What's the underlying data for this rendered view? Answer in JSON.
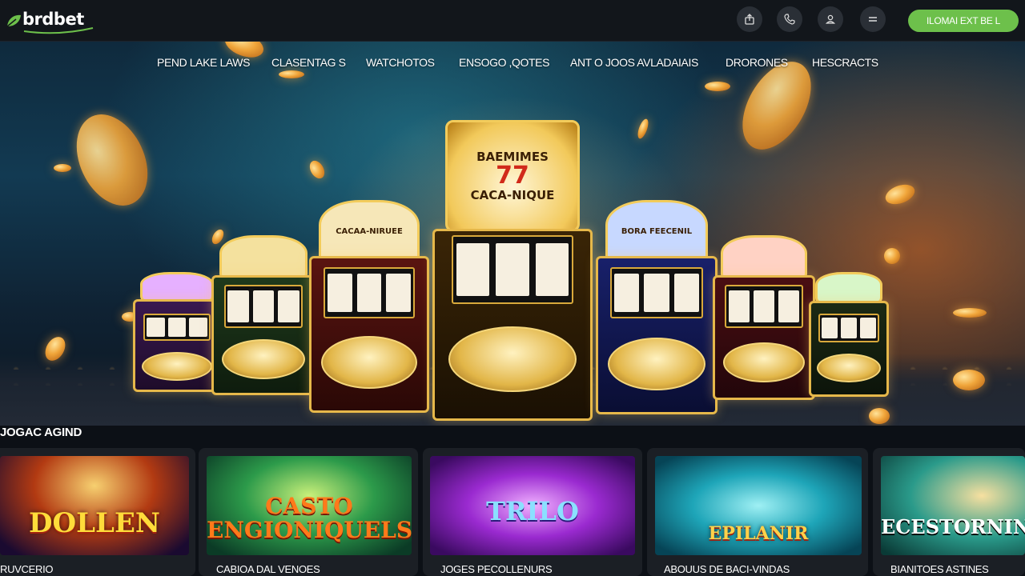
{
  "brand": {
    "name": "brdbet",
    "accent": "#6dc04b"
  },
  "header": {
    "icons": [
      "share-icon",
      "phone-icon",
      "user-icon",
      "menu-icon"
    ],
    "cta_label": "ILOMAI EXT BE L"
  },
  "nav": {
    "items": [
      "PEND LAKE LAWS",
      "CLASENTAG S",
      "WATCHOTOS",
      "ENSOGO ,QOTES",
      "ANT O JOOS AVLADAIAIS",
      "DRORONES",
      "HESCRACTS"
    ]
  },
  "hero": {
    "main_machine": {
      "top_text": "BAEMIMES",
      "number": "77",
      "bottom_text": "CACA-NIQUE"
    },
    "machines": [
      "CACAA-NIRUEE",
      "BORA FEECENIL"
    ]
  },
  "section": {
    "title": "JOGAC AGIND"
  },
  "cards": [
    {
      "caption": "RUVCERIO",
      "title": "DOLLEN"
    },
    {
      "caption": "CABIOA DAL VENOES",
      "title": "CASTO ENGIONIQUELS"
    },
    {
      "caption": "JOGES PECOLLENURS",
      "title": "TRILO"
    },
    {
      "caption": "ABOUUS DE BACI-VINDAS",
      "title": "EPILANIR"
    },
    {
      "caption": "BIANITOES ASTINES",
      "title": "ECESTORNINIU"
    }
  ]
}
